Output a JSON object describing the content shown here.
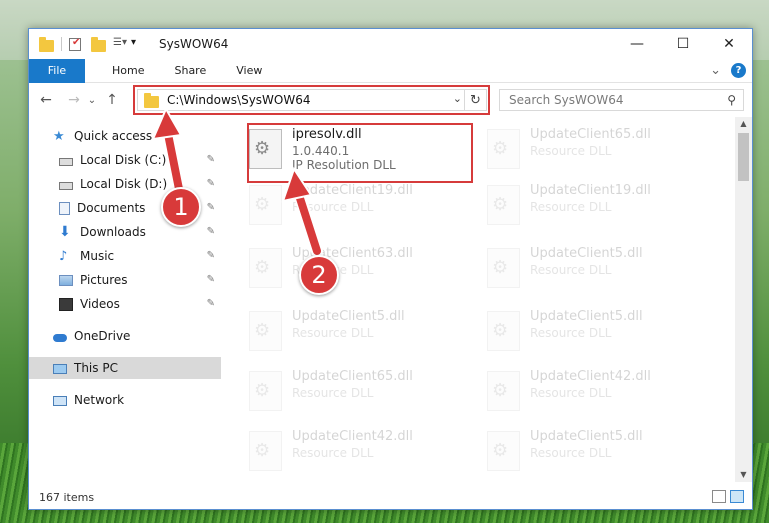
{
  "window": {
    "title": "SysWOW64",
    "minimize_glyph": "—",
    "maximize_glyph": "☐",
    "close_glyph": "✕"
  },
  "ribbon": {
    "tabs": [
      "File",
      "Home",
      "Share",
      "View"
    ],
    "help_label": "?",
    "expand_glyph": "⌄"
  },
  "nav": {
    "back_glyph": "←",
    "forward_glyph": "→",
    "recent_glyph": "⌄",
    "up_glyph": "↑",
    "address": "C:\\Windows\\SysWOW64",
    "address_dropdown_glyph": "⌄",
    "refresh_glyph": "↻",
    "search_placeholder": "Search SysWOW64",
    "search_glyph": "🔍"
  },
  "sidebar": {
    "items": [
      {
        "label": "Quick access",
        "icon": "star-icon",
        "pinned": false
      },
      {
        "label": "Local Disk (C:)",
        "icon": "drive-icon",
        "pinned": true
      },
      {
        "label": "Local Disk (D:)",
        "icon": "drive-icon",
        "pinned": true
      },
      {
        "label": "Documents",
        "icon": "document-icon",
        "pinned": true
      },
      {
        "label": "Downloads",
        "icon": "download-icon",
        "pinned": true
      },
      {
        "label": "Music",
        "icon": "music-icon",
        "pinned": true
      },
      {
        "label": "Pictures",
        "icon": "pictures-icon",
        "pinned": true
      },
      {
        "label": "Videos",
        "icon": "video-icon",
        "pinned": true
      },
      {
        "label": "OneDrive",
        "icon": "cloud-icon",
        "pinned": false
      },
      {
        "label": "This PC",
        "icon": "computer-icon",
        "pinned": false,
        "selected": true
      },
      {
        "label": "Network",
        "icon": "network-icon",
        "pinned": false
      }
    ],
    "pin_glyph": "📌"
  },
  "files": {
    "highlighted": {
      "name": "ipresolv.dll",
      "version": "1.0.440.1",
      "description": "IP Resolution DLL"
    },
    "others": [
      {
        "name": "UpdateClient65.dll",
        "description": "Resource DLL"
      },
      {
        "name": "UpdateClient19.dll",
        "description": "Resource DLL"
      },
      {
        "name": "UpdateClient19.dll",
        "description": "Resource DLL"
      },
      {
        "name": "UpdateClient63.dll",
        "description": "Resource DLL"
      },
      {
        "name": "UpdateClient5.dll",
        "description": "Resource DLL"
      },
      {
        "name": "UpdateClient5.dll",
        "description": "Resource DLL"
      },
      {
        "name": "UpdateClient5.dll",
        "description": "Resource DLL"
      },
      {
        "name": "UpdateClient65.dll",
        "description": "Resource DLL"
      },
      {
        "name": "UpdateClient42.dll",
        "description": "Resource DLL"
      },
      {
        "name": "UpdateClient42.dll",
        "description": "Resource DLL"
      },
      {
        "name": "UpdateClient5.dll",
        "description": "Resource DLL"
      }
    ]
  },
  "status": {
    "item_count": "167 items"
  },
  "annotations": {
    "step1": "1",
    "step2": "2",
    "color": "#d83a3a"
  }
}
